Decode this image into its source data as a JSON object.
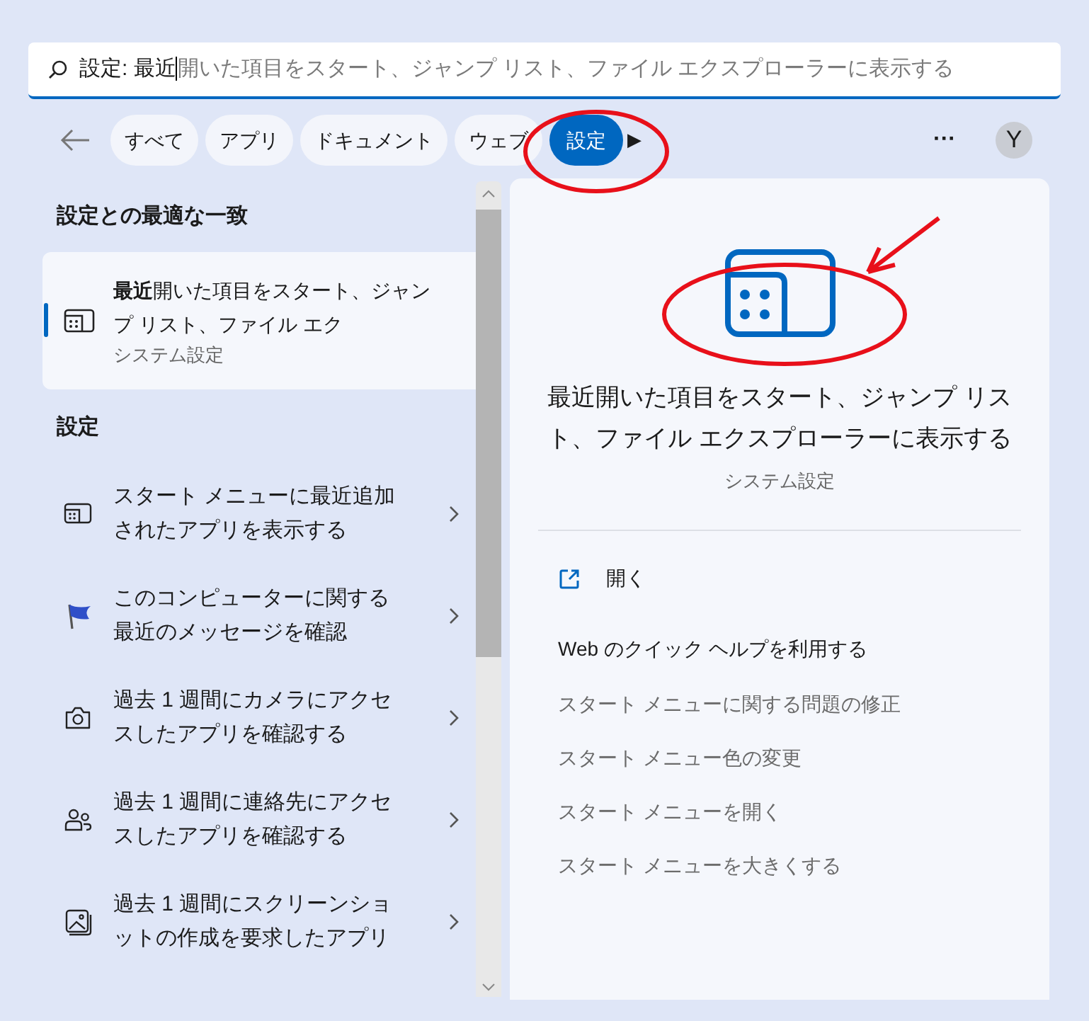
{
  "search": {
    "value": "設定: 最近",
    "suggestion": "開いた項目をスタート、ジャンプ リスト、ファイル エクスプローラーに表示する"
  },
  "filters": [
    {
      "label": "すべて",
      "selected": false
    },
    {
      "label": "アプリ",
      "selected": false
    },
    {
      "label": "ドキュメント",
      "selected": false
    },
    {
      "label": "ウェブ",
      "selected": false
    },
    {
      "label": "設定",
      "selected": true
    }
  ],
  "more_filters": "▶",
  "more": "···",
  "avatar": "Y",
  "best_match": {
    "heading": "設定との最適な一致",
    "title": "**最近**開いた項目をスタート、ジャンプ リスト、ファイル エク",
    "subtitle": "システム設定",
    "selected": true
  },
  "settings": {
    "heading": "設定",
    "items": [
      {
        "kind": "window",
        "text": "スタート メニューに最近追加されたアプリを表示する"
      },
      {
        "kind": "flag",
        "text": "このコンピューターに関する最近のメッセージを確認"
      },
      {
        "kind": "camera",
        "text": "過去 1 週間にカメラにアクセスしたアプリを確認する"
      },
      {
        "kind": "people",
        "text": "過去 1 週間に連絡先にアクセスしたアプリを確認する"
      },
      {
        "kind": "image",
        "text": "過去 1 週間にスクリーンショットの作成を要求したアプリ"
      }
    ]
  },
  "detail": {
    "title": "最近開いた項目をスタート、ジャンプ リスト、ファイル エクスプローラーに表示する",
    "subtitle": "システム設定",
    "actions": [
      {
        "kind": "open",
        "label": "開く"
      },
      {
        "kind": "primary",
        "label": "Web のクイック ヘルプを利用する"
      },
      {
        "kind": "related",
        "label": "スタート メニューに関する問題の修正"
      },
      {
        "kind": "related",
        "label": "スタート メニュー色の変更"
      },
      {
        "kind": "related",
        "label": "スタート メニューを開く"
      },
      {
        "kind": "related",
        "label": "スタート メニューを大きくする"
      }
    ]
  }
}
